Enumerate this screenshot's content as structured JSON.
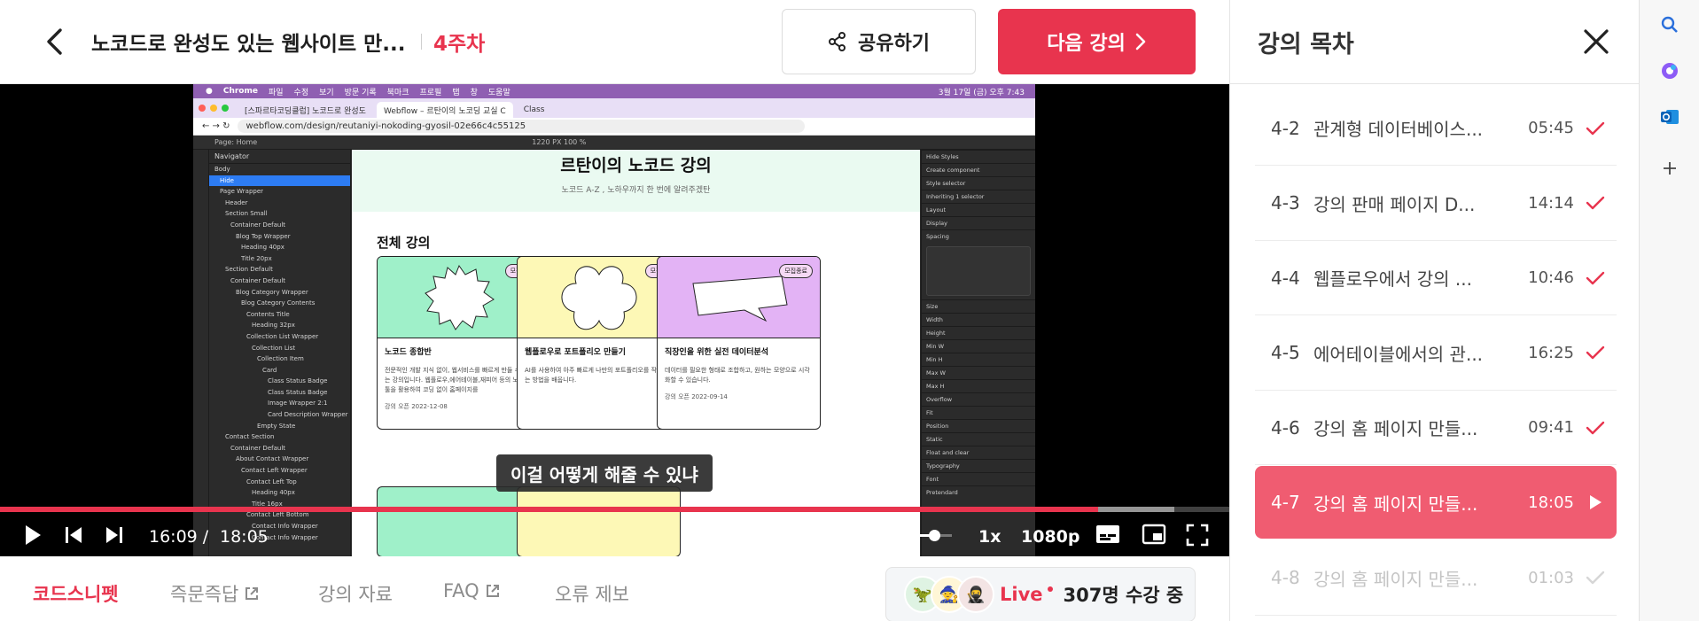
{
  "header": {
    "course_title": "노코드로 완성도 있는 웹사이트 만...",
    "week": "4주차",
    "share_label": "공유하기",
    "next_label": "다음 강의"
  },
  "video_screen": {
    "mac_menu": [
      "Chrome",
      "파일",
      "수정",
      "보기",
      "방문 기록",
      "북마크",
      "프로필",
      "탭",
      "창",
      "도움말"
    ],
    "mac_clock": "3월 17일 (금) 오후 7:43",
    "tabs": [
      "[스파르타코딩클럽] 노코드로 완성도",
      "Webflow – 르탄이의 노코딩 교실 C",
      "Class"
    ],
    "url": "webflow.com/design/reutaniyi-nokoding-gyosil-02e66c4c55125",
    "page_label": "Page: Home",
    "breakpoint": "1220 PX  100 %",
    "navigator_title": "Navigator",
    "navigator_rows": [
      "Body",
      "Hide",
      "Page Wrapper",
      "Header",
      "Section Small",
      "Container Default",
      "Blog Top Wrapper",
      "Heading 40px",
      "Title 20px",
      "Section Default",
      "Container Default",
      "Blog Category Wrapper",
      "Blog Category Contents",
      "Contents Title",
      "Heading 32px",
      "Collection List Wrapper",
      "Collection List",
      "Collection Item",
      "Card",
      "Class Status Badge",
      "Class Status Badge",
      "Image Wrapper 2:1",
      "Card Description Wrapper",
      "Empty State",
      "Contact Section",
      "Container Default",
      "About Contact Wrapper",
      "Contact Left Wrapper",
      "Contact Left Top",
      "Heading 40px",
      "Title 16px",
      "Contact Left Bottom",
      "Contact Info Wrapper",
      "Contact Info Wrapper"
    ],
    "hero_title": "르탄이의 노코드 강의",
    "hero_sub": "노코드 A-Z , 노하우까지 한 번에 알려주겠탄",
    "section_title": "전체 강의",
    "cards": [
      {
        "badge": "모집중",
        "title": "노코드 종합반",
        "desc": "전문적인 개발 지식 없이, 웹서비스를 빠르게 만들 수 있는 강의입니다. 웹플로우,에어테이블,재피어 등의 노코드 툴을 활용하여 코딩 없이 홈페이지를",
        "date": "강의 오픈 2022-12-08",
        "color": "#9ff0c9"
      },
      {
        "badge": "모집중",
        "title": "웹플로우로 포트폴리오 만들기",
        "desc": "AI를 사용하여 아주 빠르게 나만의 포트폴리오를 작성하는 방법을 배웁니다.",
        "date": "",
        "color": "#fdf8b6"
      },
      {
        "badge": "모집종료",
        "title": "직장인을 위한 실전 데이터분석",
        "desc": "데이터를 필요한 형태로 조합하고, 원하는 모양으로 시각화할 수 있습니다.",
        "date": "강의 오픈 2022-09-14",
        "color": "#e3b3f5"
      }
    ],
    "right_panel": [
      "Hide Styles",
      "Create component",
      "Style selector",
      "Inheriting 1 selector",
      "Layout",
      "Display",
      "Spacing",
      "Size",
      "Width",
      "Height",
      "Min W",
      "Min H",
      "Max W",
      "Max H",
      "Overflow",
      "Fit",
      "Position",
      "Static",
      "Float and clear",
      "Typography",
      "Font",
      "Pretendard"
    ],
    "hide_tag": "Hide"
  },
  "caption": "이걸 어떻게 해줄 수 있냐",
  "player": {
    "current_time": "16:09",
    "duration": "18:05",
    "played_fraction": 0.893,
    "buffered_fraction": 0.955,
    "volume_fraction": 0.82,
    "speed": "1x",
    "quality": "1080p"
  },
  "subtabs": [
    {
      "label": "코드스니펫",
      "external": false
    },
    {
      "label": "즉문즉답",
      "external": true
    },
    {
      "label": "강의 자료",
      "external": false
    },
    {
      "label": "FAQ",
      "external": true
    },
    {
      "label": "오류 제보",
      "external": false
    }
  ],
  "live": {
    "label": "Live",
    "count": "307명 수강 중"
  },
  "sidebar": {
    "title": "강의 목차",
    "lessons": [
      {
        "num": "4-2",
        "title": "관계형 데이터베이스...",
        "duration": "05:45",
        "state": "done"
      },
      {
        "num": "4-3",
        "title": "강의 판매 페이지 D...",
        "duration": "14:14",
        "state": "done"
      },
      {
        "num": "4-4",
        "title": "웹플로우에서 강의 ...",
        "duration": "10:46",
        "state": "done"
      },
      {
        "num": "4-5",
        "title": "에어테이블에서의 관...",
        "duration": "16:25",
        "state": "done"
      },
      {
        "num": "4-6",
        "title": "강의 홈 페이지 만들...",
        "duration": "09:41",
        "state": "done"
      },
      {
        "num": "4-7",
        "title": "강의 홈 페이지 만들...",
        "duration": "18:05",
        "state": "current"
      },
      {
        "num": "4-8",
        "title": "강의 홈 페이지 만들...",
        "duration": "01:03",
        "state": "dim"
      }
    ]
  },
  "colors": {
    "accent": "#e8344e",
    "current_lesson": "#f05c71"
  }
}
